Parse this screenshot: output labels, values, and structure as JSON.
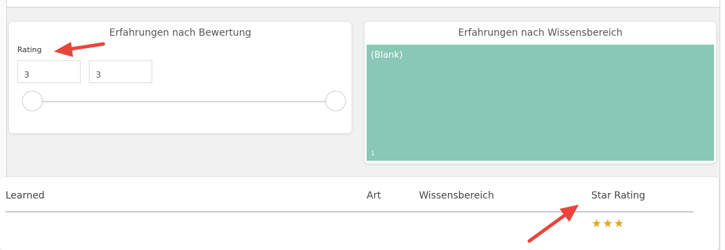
{
  "slicer": {
    "title": "Erfahrungen nach Bewertung",
    "field_label": "Rating",
    "min_value": "3",
    "max_value": "3"
  },
  "treemap": {
    "title": "Erfahrungen nach Wissensbereich",
    "tile_label": "(Blank)",
    "tile_value": "1",
    "tile_color": "#88c8b4"
  },
  "table": {
    "columns": [
      "Learned",
      "Art",
      "Wissensbereich",
      "Star Rating"
    ],
    "rows": [
      {
        "star_rating": "★★★",
        "star_count": 3
      }
    ]
  },
  "colors": {
    "annotation_arrow": "#e8453c",
    "star": "#e0a91f"
  },
  "icons": {
    "annotation": "red-arrow-icon",
    "rating": "star-icon"
  }
}
